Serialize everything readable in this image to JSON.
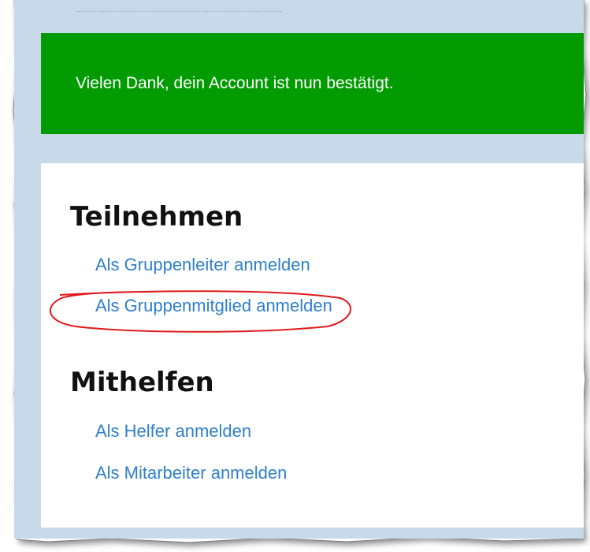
{
  "alert": {
    "message": "Vielen Dank, dein Account ist nun bestätigt."
  },
  "sections": [
    {
      "title": "Teilnehmen",
      "links": [
        "Als Gruppenleiter anmelden",
        "Als Gruppenmitglied anmelden"
      ]
    },
    {
      "title": "Mithelfen",
      "links": [
        "Als Helfer anmelden",
        "Als Mitarbeiter anmelden"
      ]
    }
  ],
  "colors": {
    "success": "#029b02",
    "link": "#2f80c9",
    "highlight_circle": "#e0191b",
    "page_bg": "#c8daea"
  }
}
